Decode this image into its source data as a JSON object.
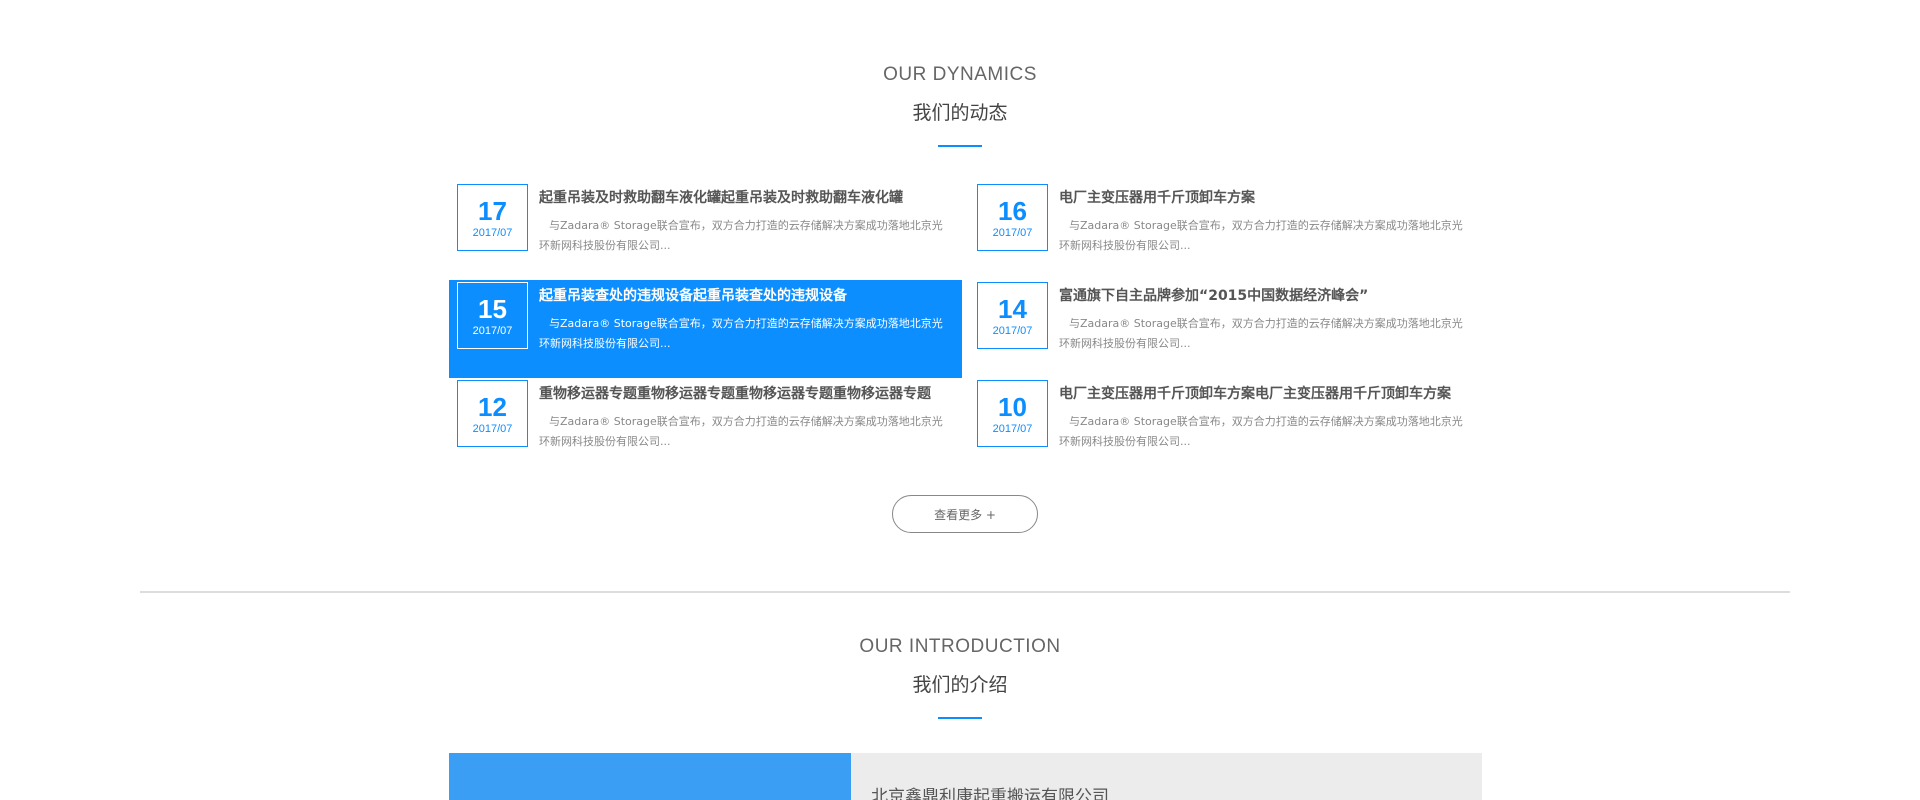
{
  "dynamics": {
    "en": "OUR DYNAMICS",
    "cn": "我们的动态"
  },
  "news": [
    {
      "day": "17",
      "ym": "2017/07",
      "title": "起重吊装及时救助翻车液化罐起重吊装及时救助翻车液化罐",
      "desc": "与Zadara® Storage联合宣布，双方合力打造的云存储解决方案成功落地北京光环新网科技股份有限公司..."
    },
    {
      "day": "16",
      "ym": "2017/07",
      "title": "电厂主变压器用千斤顶卸车方案",
      "desc": "与Zadara® Storage联合宣布，双方合力打造的云存储解决方案成功落地北京光环新网科技股份有限公司..."
    },
    {
      "day": "15",
      "ym": "2017/07",
      "title": "起重吊装查处的违规设备起重吊装查处的违规设备",
      "desc": "与Zadara® Storage联合宣布，双方合力打造的云存储解决方案成功落地北京光环新网科技股份有限公司..."
    },
    {
      "day": "14",
      "ym": "2017/07",
      "title": "富通旗下自主品牌参加“2015中国数据经济峰会”",
      "desc": "与Zadara® Storage联合宣布，双方合力打造的云存储解决方案成功落地北京光环新网科技股份有限公司..."
    },
    {
      "day": "12",
      "ym": "2017/07",
      "title": "重物移运器专题重物移运器专题重物移运器专题重物移运器专题",
      "desc": "与Zadara® Storage联合宣布，双方合力打造的云存储解决方案成功落地北京光环新网科技股份有限公司..."
    },
    {
      "day": "10",
      "ym": "2017/07",
      "title": "电厂主变压器用千斤顶卸车方案电厂主变压器用千斤顶卸车方案",
      "desc": "与Zadara® Storage联合宣布，双方合力打造的云存储解决方案成功落地北京光环新网科技股份有限公司..."
    }
  ],
  "more_label": "查看更多 +",
  "intro": {
    "en": "OUR INTRODUCTION",
    "cn": "我们的介绍",
    "company": "北京鑫鼎利康起重搬运有限公司"
  },
  "colors": {
    "accent": "#0d8eff",
    "intro_left": "#3a9ef5",
    "intro_right": "#ececec"
  }
}
